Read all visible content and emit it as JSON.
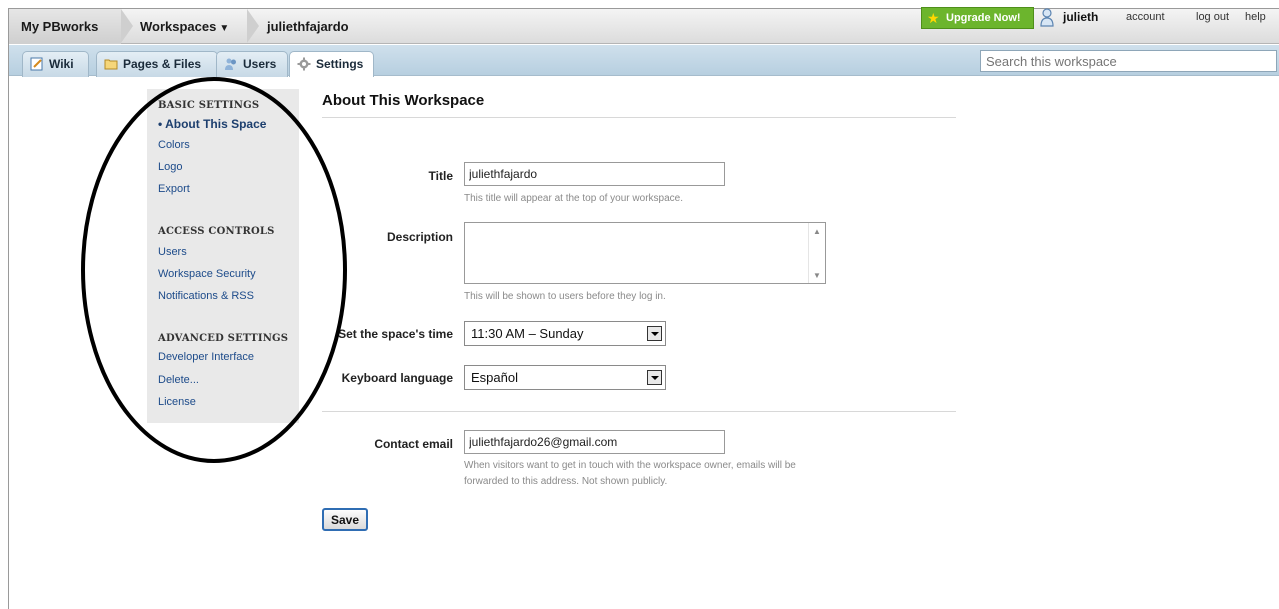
{
  "topbar": {
    "my_pbworks": "My PBworks",
    "workspaces": "Workspaces",
    "workspace_name": "juliethfajardo",
    "upgrade": "Upgrade Now!",
    "username": "julieth",
    "account": "account",
    "logout": "log out",
    "help": "help"
  },
  "tabs": [
    {
      "label": "Wiki",
      "icon": "edit-page-icon"
    },
    {
      "label": "Pages & Files",
      "icon": "folder-icon"
    },
    {
      "label": "Users",
      "icon": "users-icon"
    },
    {
      "label": "Settings",
      "icon": "gear-icon",
      "active": true
    }
  ],
  "search": {
    "placeholder": "Search this workspace"
  },
  "sidebar": {
    "basic_heading": "BASIC SETTINGS",
    "basic_items": [
      "About This Space",
      "Colors",
      "Logo",
      "Export"
    ],
    "access_heading": "ACCESS CONTROLS",
    "access_items": [
      "Users",
      "Workspace Security",
      "Notifications & RSS"
    ],
    "advanced_heading": "ADVANCED SETTINGS",
    "advanced_items": [
      "Developer Interface",
      "Delete...",
      "License"
    ],
    "current_marker": "•"
  },
  "main": {
    "title": "About This Workspace",
    "title_label": "Title",
    "title_value": "juliethfajardo",
    "title_hint": "This title will appear at the top of your workspace.",
    "description_label": "Description",
    "description_hint": "This will be shown to users before they log in.",
    "time_label": "Set the space's time",
    "time_value": "11:30 AM – Sunday",
    "language_label": "Keyboard language",
    "language_value": "Español",
    "email_label": "Contact email",
    "email_value": "juliethfajardo26@gmail.com",
    "email_hint_1": "When visitors want to get in touch with the workspace owner, emails will be",
    "email_hint_2": "forwarded to this address. Not shown publicly.",
    "save": "Save"
  },
  "colors": {
    "upgrade_green": "#6cb52d",
    "link_blue": "#1d4b8a",
    "tabbar_blue": "#c3d7e6",
    "sidebar_gray": "#e9e9e9"
  }
}
